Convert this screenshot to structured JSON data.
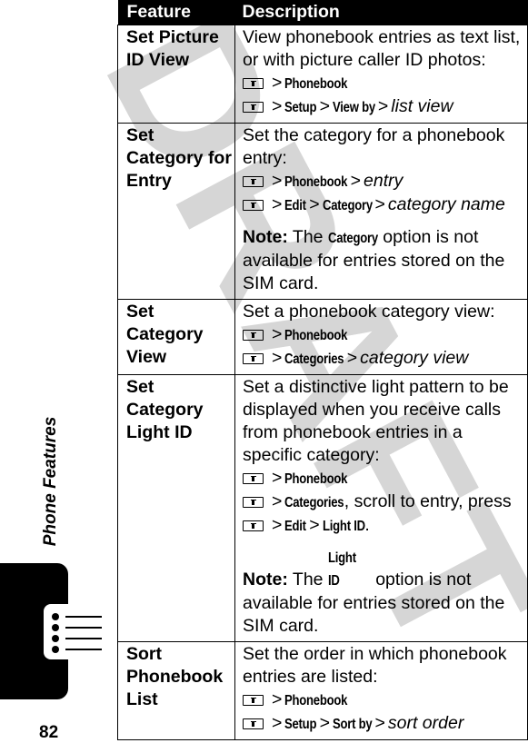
{
  "watermark": "DRAFT",
  "section_title": "Phone Features",
  "page_number": "82",
  "table": {
    "headers": {
      "feature": "Feature",
      "description": "Description"
    },
    "rows": [
      {
        "feature": "Set Picture ID View",
        "intro": "View phonebook entries as text list, or with picture caller ID photos:",
        "paths": [
          {
            "steps": [
              "Phonebook"
            ],
            "tail_italic": ""
          },
          {
            "steps": [
              "Setup",
              "View by"
            ],
            "tail_italic": "list view"
          }
        ]
      },
      {
        "feature": "Set Category for Entry",
        "intro": "Set the category for a phonebook entry:",
        "paths": [
          {
            "steps": [
              "Phonebook"
            ],
            "tail_italic": "entry"
          },
          {
            "steps": [
              "Edit",
              "Category"
            ],
            "tail_italic": "category name"
          }
        ],
        "note": {
          "label": "Note:",
          "pre": "The",
          "command": "Category",
          "post": "option is not available for entries stored on the SIM card."
        }
      },
      {
        "feature": "Set Category View",
        "intro": "Set a phonebook category view:",
        "paths": [
          {
            "steps": [
              "Phonebook"
            ],
            "tail_italic": ""
          },
          {
            "steps": [
              "Categories"
            ],
            "tail_italic": "category view"
          }
        ]
      },
      {
        "feature": "Set Category Light ID",
        "intro": "Set a distinctive light pattern to be displayed when you receive calls from phonebook entries in a specific category:",
        "paths": [
          {
            "steps": [
              "Phonebook"
            ],
            "tail_italic": ""
          },
          {
            "steps": [
              "Categories"
            ],
            "tail_plain": ", scroll to entry, press"
          },
          {
            "steps": [
              "Edit",
              "Light ID"
            ],
            "tail_plain": "."
          }
        ],
        "note": {
          "label": "Note:",
          "pre": "The",
          "command": "Light ID",
          "post": "option is not available for entries stored on the SIM card."
        }
      },
      {
        "feature": "Sort Phonebook List",
        "intro": "Set the order in which phonebook entries are listed:",
        "paths": [
          {
            "steps": [
              "Phonebook"
            ],
            "tail_italic": ""
          },
          {
            "steps": [
              "Setup",
              "Sort by"
            ],
            "tail_italic": "sort order"
          }
        ]
      }
    ]
  },
  "icons": {
    "menu_key": "menu-key-icon",
    "section_tab": "phonebook-list-icon"
  }
}
